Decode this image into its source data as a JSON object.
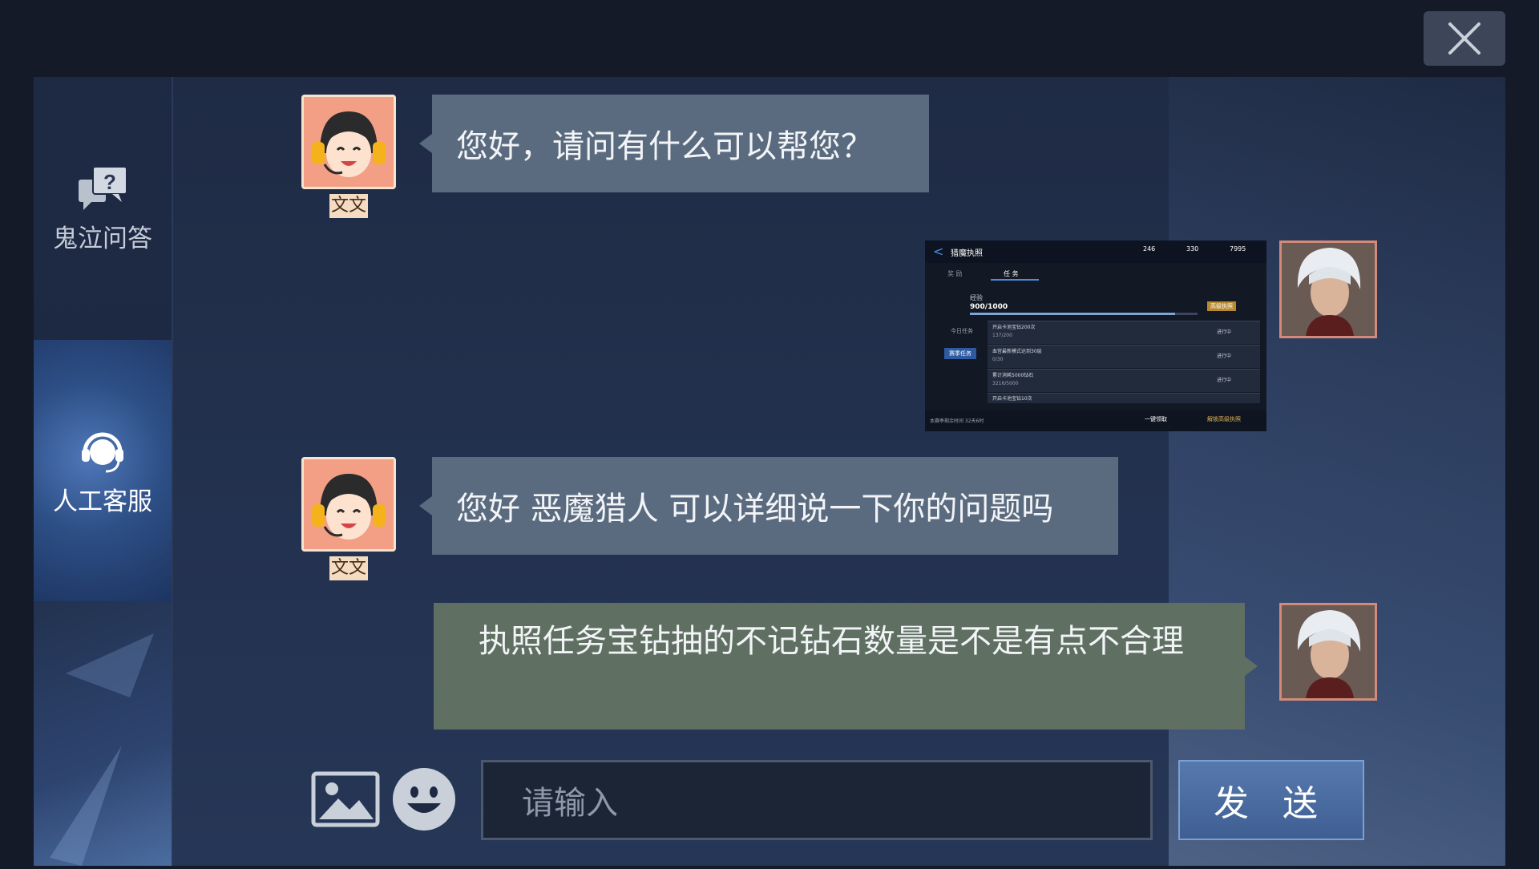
{
  "sidebar": {
    "items": [
      {
        "label": "鬼泣问答",
        "icon": "faq-chat-icon"
      },
      {
        "label": "人工客服",
        "icon": "headset-icon",
        "active": true
      }
    ]
  },
  "chat": {
    "messages": [
      {
        "from": "agent",
        "name": "文文",
        "text": "您好，请问有什么可以帮您？"
      },
      {
        "from": "user",
        "type": "image"
      },
      {
        "from": "agent",
        "name": "文文",
        "text": "您好 恶魔猎人 可以详细说一下你的问题吗"
      },
      {
        "from": "user",
        "type": "text",
        "text": "执照任务宝钻抽的不记钻石数量是不是有点不合理"
      }
    ]
  },
  "attachment": {
    "title": "猎魔执照",
    "tabs": [
      "奖 励",
      "任 务"
    ],
    "currencies": [
      "246",
      "330",
      "7995"
    ],
    "level_label": "经验",
    "level_value": "900/1000",
    "side_tabs": [
      "今日任务",
      "赛季任务"
    ],
    "tasks": [
      {
        "name": "开启卡池宝钻200次",
        "progress": "137/200",
        "status": "进行中"
      },
      {
        "name": "血宫最新模式达到30层",
        "progress": "0/30",
        "status": "进行中"
      },
      {
        "name": "累计消耗5000钻石",
        "progress": "3216/5000",
        "status": "进行中"
      },
      {
        "name": "开启卡池宝钻10次",
        "progress": "",
        "status": ""
      }
    ],
    "footer_left": "本赛季剩余时间  32天6时",
    "footer_btn1": "一键领取",
    "footer_btn2": "解锁高级执照",
    "unlock_badge": "高级执照"
  },
  "composer": {
    "placeholder": "请输入",
    "send_label": "发 送",
    "image_icon": "image-icon",
    "emoji_icon": "emoji-icon"
  },
  "colors": {
    "agent_bubble": "#5b6b7f",
    "user_bubble": "#5f7062",
    "send_button": "#4a6ba0"
  }
}
